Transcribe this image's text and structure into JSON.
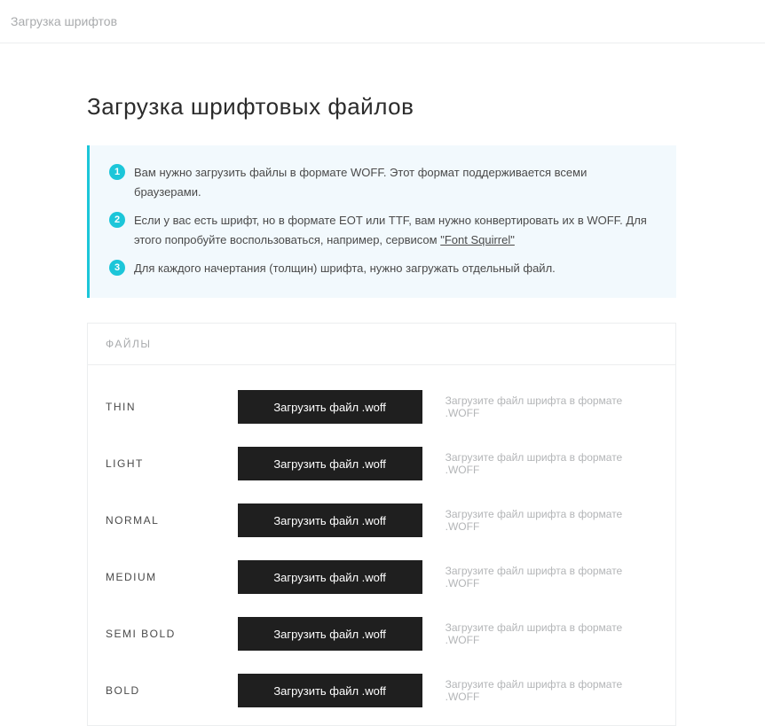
{
  "topBar": {
    "title": "Загрузка шрифтов"
  },
  "heading": "Загрузка шрифтовых файлов",
  "info": {
    "item1": {
      "num": "1",
      "text": "Вам нужно загрузить файлы в формате WOFF. Этот формат поддерживается всеми браузерами."
    },
    "item2": {
      "num": "2",
      "textBefore": "Если у вас есть шрифт, но в формате EOT или TTF, вам нужно конвертировать их в WOFF. Для этого попробуйте воспользоваться, например, сервисом ",
      "linkText": "\"Font Squirrel\""
    },
    "item3": {
      "num": "3",
      "text": "Для каждого начертания (толщин) шрифта, нужно загружать отдельный файл."
    }
  },
  "filesHeader": "ФАЙЛЫ",
  "uploadButtonLabel": "Загрузить файл .woff",
  "uploadHint": "Загрузите файл шрифта в формате .WOFF",
  "weights": {
    "thin": "THIN",
    "light": "LIGHT",
    "normal": "NORMAL",
    "medium": "MEDIUM",
    "semibold": "SEMI BOLD",
    "bold": "BOLD"
  }
}
